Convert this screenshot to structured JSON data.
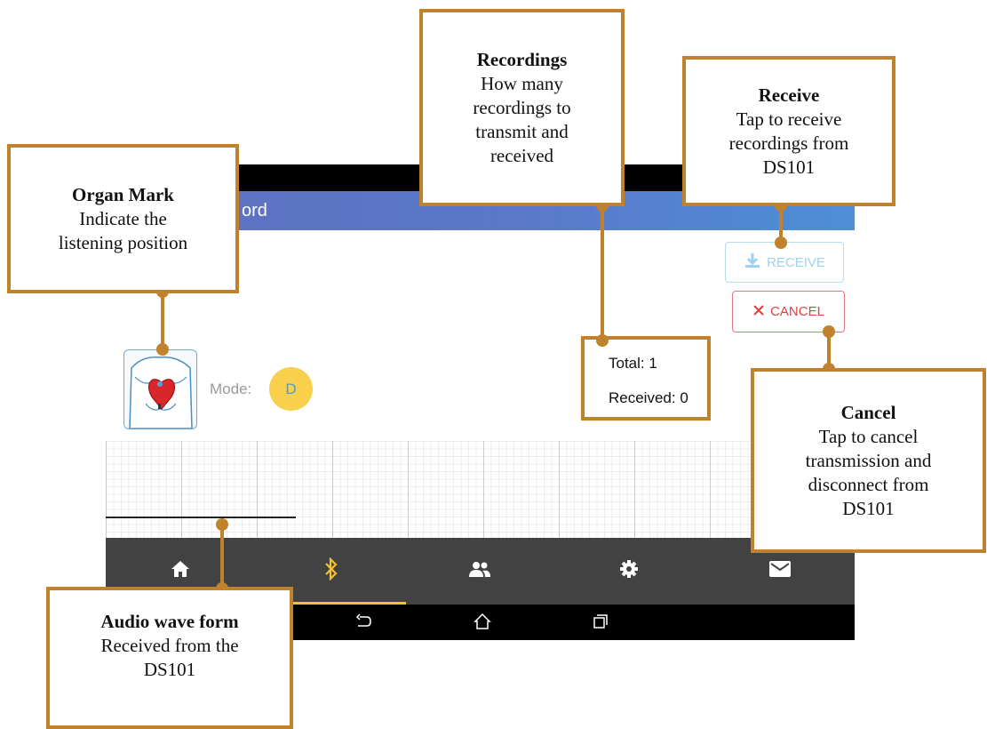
{
  "app": {
    "title": "ord"
  },
  "receive_button": {
    "label": "RECEIVE",
    "icon": "download-icon"
  },
  "cancel_button": {
    "label": "CANCEL",
    "icon": "close-icon"
  },
  "mode": {
    "label": "Mode:",
    "value": "D"
  },
  "counts": {
    "total": "Total: 1",
    "received": "Received: 0"
  },
  "nav": {
    "tabs": [
      "home-icon",
      "bluetooth-icon",
      "people-icon",
      "settings-icon",
      "mail-icon"
    ],
    "active": "bluetooth-icon"
  },
  "colors": {
    "accent": "#f6c12e",
    "callout_border": "#c0822c",
    "appbar": "#5b78c9",
    "cancel": "#e0403c",
    "receive": "#9fd2ef"
  },
  "callouts": {
    "organ_mark": {
      "title": "Organ Mark",
      "lines": [
        "Indicate the",
        "listening position"
      ]
    },
    "recordings": {
      "title": "Recordings",
      "lines": [
        "How many",
        "recordings to",
        "transmit and",
        "received"
      ]
    },
    "receive": {
      "title": "Receive",
      "lines": [
        "Tap to receive",
        "recordings from",
        "DS101"
      ]
    },
    "cancel": {
      "title": "Cancel",
      "lines": [
        "Tap to cancel",
        "transmission and",
        "disconnect from",
        "DS101"
      ]
    },
    "audio": {
      "title": "Audio wave form",
      "lines": [
        "Received from the",
        "DS101"
      ]
    }
  }
}
